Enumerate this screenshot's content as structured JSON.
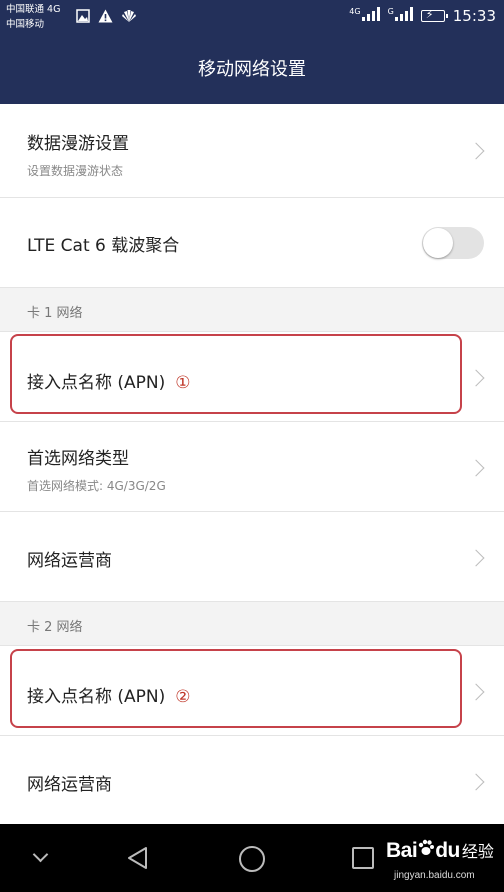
{
  "status_bar": {
    "carrier_1": "中国联通 4G",
    "carrier_2": "中国移动",
    "sim1_network": "4G",
    "sim2_network": "G",
    "time": "15:33"
  },
  "header": {
    "title": "移动网络设置"
  },
  "settings": {
    "data_roaming": {
      "title": "数据漫游设置",
      "subtitle": "设置数据漫游状态"
    },
    "lte_cat6": {
      "title": "LTE Cat 6 载波聚合",
      "enabled": false
    },
    "sim1_section": "卡 1 网络",
    "sim1_apn": {
      "title": "接入点名称 (APN)",
      "marker": "①"
    },
    "preferred_network": {
      "title": "首选网络类型",
      "subtitle": "首选网络模式: 4G/3G/2G"
    },
    "sim1_operator": {
      "title": "网络运营商"
    },
    "sim2_section": "卡 2 网络",
    "sim2_apn": {
      "title": "接入点名称 (APN)",
      "marker": "②"
    },
    "sim2_operator": {
      "title": "网络运营商"
    }
  },
  "watermark": {
    "brand": "Bai",
    "brand_end": "du",
    "brand_cn": "经验",
    "url": "jingyan.baidu.com"
  },
  "colors": {
    "header_bg": "#23305a",
    "highlight": "#c6424a",
    "marker": "#c0392b"
  },
  "icons": [
    "image-icon",
    "warning-icon",
    "huawei-icon",
    "signal-icon",
    "battery-icon",
    "chevron-right-icon",
    "nav-down-icon",
    "back-icon",
    "home-icon",
    "recent-apps-icon",
    "paw-icon"
  ]
}
